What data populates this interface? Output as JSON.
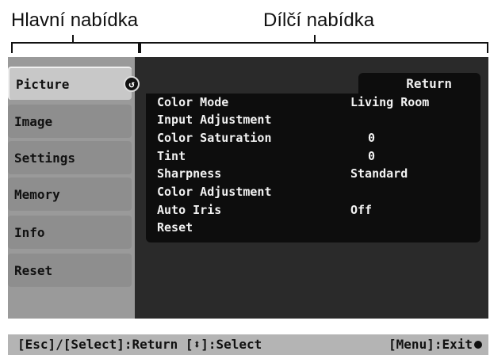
{
  "captions": {
    "main_menu": "Hlavní nabídka",
    "sub_menu": "Dílčí nabídka"
  },
  "main_menu": {
    "items": [
      {
        "label": "Picture",
        "active": true
      },
      {
        "label": "Image"
      },
      {
        "label": "Settings"
      },
      {
        "label": "Memory"
      },
      {
        "label": "Info"
      },
      {
        "label": "Reset"
      }
    ],
    "active_indicator_icon": "return-arrow-icon"
  },
  "sub_menu": {
    "return_label": "Return",
    "rows": [
      {
        "label": "Color Mode",
        "value": "Living Room"
      },
      {
        "label": "Input Adjustment",
        "value": ""
      },
      {
        "label": "Color Saturation",
        "value": "0"
      },
      {
        "label": "Tint",
        "value": "0"
      },
      {
        "label": "Sharpness",
        "value": "Standard"
      },
      {
        "label": "Color Adjustment",
        "value": ""
      },
      {
        "label": "Auto Iris",
        "value": "Off"
      },
      {
        "label": "Reset",
        "value": ""
      }
    ]
  },
  "status_bar": {
    "left_text": "[Esc]/[Select]:Return [⬍]:Select",
    "right_text": "[Menu]:Exit"
  },
  "colors": {
    "screen_bg": "#9a9a9a",
    "panel_bg": "#0d0d0d",
    "menu_item_bg": "#8e8e8e",
    "menu_active_bg": "#c8c8c8",
    "status_bg": "#b4b4b4"
  }
}
